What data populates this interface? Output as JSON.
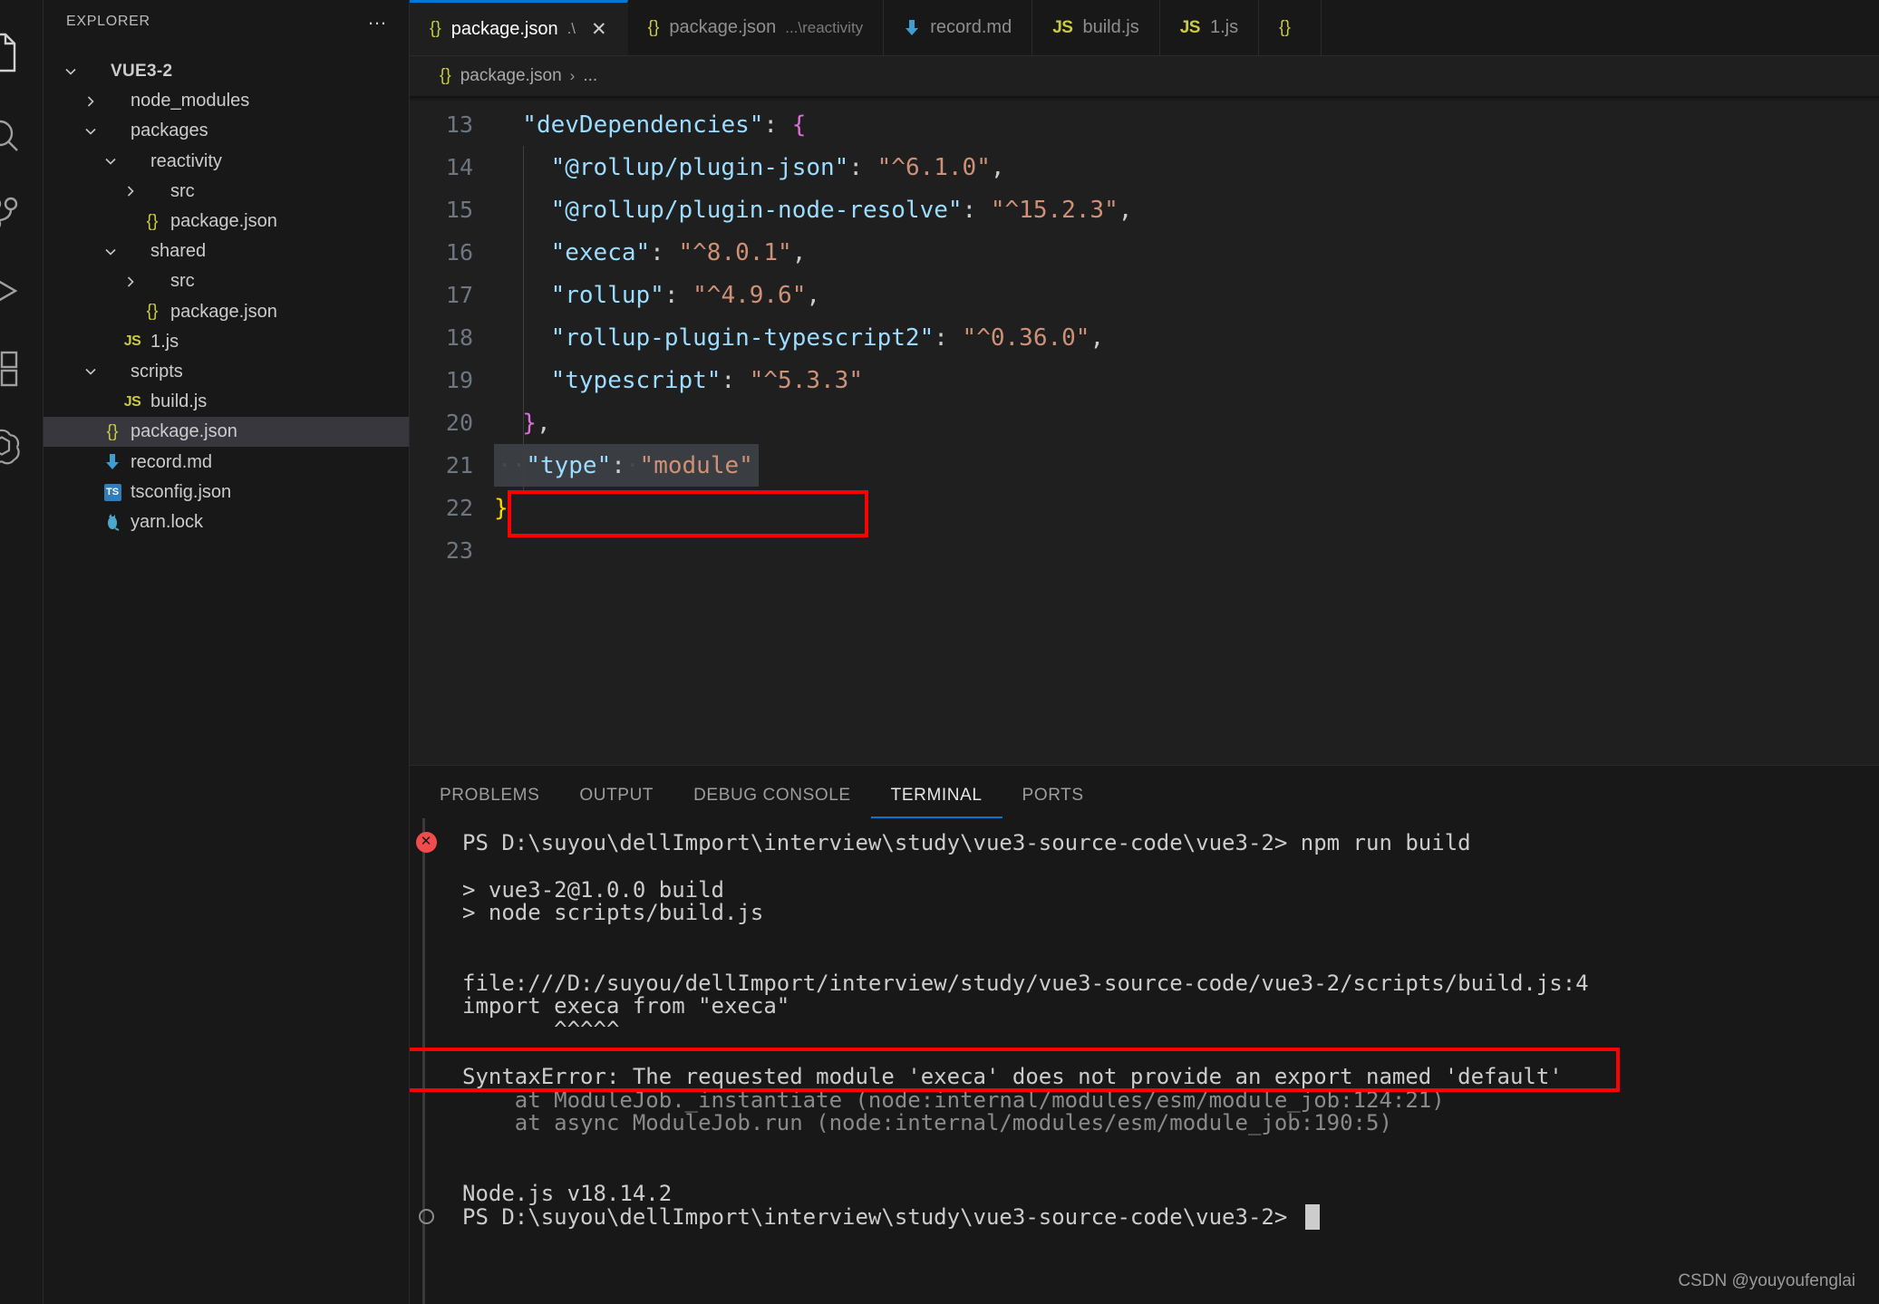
{
  "activity_bar": {
    "items": [
      {
        "name": "explorer-icon",
        "label": "Explorer"
      },
      {
        "name": "search-icon",
        "label": "Search"
      },
      {
        "name": "source-control-icon",
        "label": "Source Control"
      },
      {
        "name": "run-debug-icon",
        "label": "Run and Debug"
      },
      {
        "name": "extensions-icon",
        "label": "Extensions"
      },
      {
        "name": "chatgpt-icon",
        "label": "ChatGPT"
      }
    ]
  },
  "sidebar": {
    "title": "EXPLORER",
    "more_label": "…",
    "tree": [
      {
        "label": "VUE3-2",
        "indent": 0,
        "type": "root",
        "twisty": "down",
        "icon": "none",
        "selected": false
      },
      {
        "label": "node_modules",
        "indent": 1,
        "type": "folder",
        "twisty": "right",
        "icon": "none",
        "selected": false
      },
      {
        "label": "packages",
        "indent": 1,
        "type": "folder",
        "twisty": "down",
        "icon": "none",
        "selected": false
      },
      {
        "label": "reactivity",
        "indent": 2,
        "type": "folder",
        "twisty": "down",
        "icon": "none",
        "selected": false
      },
      {
        "label": "src",
        "indent": 3,
        "type": "folder",
        "twisty": "right",
        "icon": "none",
        "selected": false
      },
      {
        "label": "package.json",
        "indent": 3,
        "type": "file",
        "twisty": "none",
        "icon": "json",
        "selected": false
      },
      {
        "label": "shared",
        "indent": 2,
        "type": "folder",
        "twisty": "down",
        "icon": "none",
        "selected": false
      },
      {
        "label": "src",
        "indent": 3,
        "type": "folder",
        "twisty": "right",
        "icon": "none",
        "selected": false
      },
      {
        "label": "package.json",
        "indent": 3,
        "type": "file",
        "twisty": "none",
        "icon": "json",
        "selected": false
      },
      {
        "label": "1.js",
        "indent": 2,
        "type": "file",
        "twisty": "none",
        "icon": "js",
        "selected": false
      },
      {
        "label": "scripts",
        "indent": 1,
        "type": "folder",
        "twisty": "down",
        "icon": "none",
        "selected": false
      },
      {
        "label": "build.js",
        "indent": 2,
        "type": "file",
        "twisty": "none",
        "icon": "js",
        "selected": false
      },
      {
        "label": "package.json",
        "indent": 1,
        "type": "file",
        "twisty": "none",
        "icon": "json",
        "selected": true
      },
      {
        "label": "record.md",
        "indent": 1,
        "type": "file",
        "twisty": "none",
        "icon": "md",
        "selected": false
      },
      {
        "label": "tsconfig.json",
        "indent": 1,
        "type": "file",
        "twisty": "none",
        "icon": "ts",
        "selected": false
      },
      {
        "label": "yarn.lock",
        "indent": 1,
        "type": "file",
        "twisty": "none",
        "icon": "yarn",
        "selected": false
      }
    ]
  },
  "tabs": [
    {
      "label": "package.json",
      "desc": ".\\",
      "icon": "json",
      "active": true,
      "close": "✕"
    },
    {
      "label": "package.json",
      "desc": "...\\reactivity",
      "icon": "json",
      "active": false,
      "close": ""
    },
    {
      "label": "record.md",
      "desc": "",
      "icon": "md",
      "active": false,
      "close": ""
    },
    {
      "label": "build.js",
      "desc": "",
      "icon": "js",
      "active": false,
      "close": ""
    },
    {
      "label": "1.js",
      "desc": "",
      "icon": "js",
      "active": false,
      "close": ""
    },
    {
      "label": "",
      "desc": "",
      "icon": "json",
      "active": false,
      "close": ""
    }
  ],
  "breadcrumb": {
    "icon": "json",
    "file": "package.json",
    "separator": "›",
    "tail": "..."
  },
  "editor": {
    "lines": [
      {
        "num": "13",
        "indent": 1,
        "segments": [
          {
            "t": "\"devDependencies\"",
            "c": "k"
          },
          {
            "t": ": ",
            "c": "punct"
          },
          {
            "t": "{",
            "c": "p-pink"
          }
        ]
      },
      {
        "num": "14",
        "indent": 2,
        "segments": [
          {
            "t": "\"@rollup/plugin-json\"",
            "c": "k"
          },
          {
            "t": ": ",
            "c": "punct"
          },
          {
            "t": "\"^6.1.0\"",
            "c": "v"
          },
          {
            "t": ",",
            "c": "punct"
          }
        ]
      },
      {
        "num": "15",
        "indent": 2,
        "segments": [
          {
            "t": "\"@rollup/plugin-node-resolve\"",
            "c": "k"
          },
          {
            "t": ": ",
            "c": "punct"
          },
          {
            "t": "\"^15.2.3\"",
            "c": "v"
          },
          {
            "t": ",",
            "c": "punct"
          }
        ]
      },
      {
        "num": "16",
        "indent": 2,
        "segments": [
          {
            "t": "\"execa\"",
            "c": "k"
          },
          {
            "t": ": ",
            "c": "punct"
          },
          {
            "t": "\"^8.0.1\"",
            "c": "v"
          },
          {
            "t": ",",
            "c": "punct"
          }
        ]
      },
      {
        "num": "17",
        "indent": 2,
        "segments": [
          {
            "t": "\"rollup\"",
            "c": "k"
          },
          {
            "t": ": ",
            "c": "punct"
          },
          {
            "t": "\"^4.9.6\"",
            "c": "v"
          },
          {
            "t": ",",
            "c": "punct"
          }
        ]
      },
      {
        "num": "18",
        "indent": 2,
        "segments": [
          {
            "t": "\"rollup-plugin-typescript2\"",
            "c": "k"
          },
          {
            "t": ": ",
            "c": "punct"
          },
          {
            "t": "\"^0.36.0\"",
            "c": "v"
          },
          {
            "t": ",",
            "c": "punct"
          }
        ]
      },
      {
        "num": "19",
        "indent": 2,
        "segments": [
          {
            "t": "\"typescript\"",
            "c": "k"
          },
          {
            "t": ": ",
            "c": "punct"
          },
          {
            "t": "\"^5.3.3\"",
            "c": "v"
          }
        ]
      },
      {
        "num": "20",
        "indent": 1,
        "segments": [
          {
            "t": "}",
            "c": "p-pink"
          },
          {
            "t": ",",
            "c": "punct"
          }
        ]
      },
      {
        "num": "21",
        "indent": 1,
        "highlighted": true,
        "segments": [
          {
            "t": "··",
            "c": "ws-dot"
          },
          {
            "t": "\"type\"",
            "c": "k"
          },
          {
            "t": ":",
            "c": "punct"
          },
          {
            "t": "·",
            "c": "ws-dot"
          },
          {
            "t": "\"module\"",
            "c": "v"
          }
        ]
      },
      {
        "num": "22",
        "indent": 0,
        "segments": [
          {
            "t": "}",
            "c": "p-yellow"
          }
        ]
      },
      {
        "num": "23",
        "indent": 0,
        "segments": []
      }
    ],
    "highlight_note": "red annotation box around line 21"
  },
  "panel": {
    "tabs": [
      {
        "label": "PROBLEMS",
        "active": false
      },
      {
        "label": "OUTPUT",
        "active": false
      },
      {
        "label": "DEBUG CONSOLE",
        "active": false
      },
      {
        "label": "TERMINAL",
        "active": true
      },
      {
        "label": "PORTS",
        "active": false
      }
    ],
    "terminal_lines": [
      {
        "gutter": "error",
        "text": "PS D:\\suyou\\dellImport\\interview\\study\\vue3-source-code\\vue3-2> npm run build",
        "style": "normal"
      },
      {
        "gutter": "",
        "text": "",
        "style": "normal"
      },
      {
        "gutter": "",
        "text": "> vue3-2@1.0.0 build",
        "style": "normal"
      },
      {
        "gutter": "",
        "text": "> node scripts/build.js",
        "style": "normal"
      },
      {
        "gutter": "",
        "text": "",
        "style": "normal"
      },
      {
        "gutter": "",
        "text": "",
        "style": "normal"
      },
      {
        "gutter": "",
        "text": "file:///D:/suyou/dellImport/interview/study/vue3-source-code/vue3-2/scripts/build.js:4",
        "style": "normal"
      },
      {
        "gutter": "",
        "text": "import execa from \"execa\"",
        "style": "normal"
      },
      {
        "gutter": "",
        "text": "       ^^^^^",
        "style": "normal"
      },
      {
        "gutter": "",
        "text": "",
        "style": "normal"
      },
      {
        "gutter": "",
        "text": "SyntaxError: The requested module 'execa' does not provide an export named 'default'",
        "style": "normal"
      },
      {
        "gutter": "",
        "text": "    at ModuleJob._instantiate (node:internal/modules/esm/module_job:124:21)",
        "style": "dim"
      },
      {
        "gutter": "",
        "text": "    at async ModuleJob.run (node:internal/modules/esm/module_job:190:5)",
        "style": "dim"
      },
      {
        "gutter": "",
        "text": "",
        "style": "normal"
      },
      {
        "gutter": "",
        "text": "",
        "style": "normal"
      },
      {
        "gutter": "",
        "text": "Node.js v18.14.2",
        "style": "normal"
      },
      {
        "gutter": "ok",
        "text": "PS D:\\suyou\\dellImport\\interview\\study\\vue3-source-code\\vue3-2> ",
        "style": "prompt"
      }
    ],
    "error_highlight_note": "red annotation box around SyntaxError line"
  },
  "watermark": "CSDN @youyoufenglai",
  "colors": {
    "accent": "#0078d4",
    "annotation": "#ff0000",
    "editor_bg": "#1f1f1f",
    "sidebar_bg": "#181818",
    "json_key": "#9cdcfe",
    "json_value": "#ce9178",
    "bracket_pink": "#da70d6",
    "bracket_yellow": "#ffd700",
    "error_red": "#f14c4c"
  }
}
